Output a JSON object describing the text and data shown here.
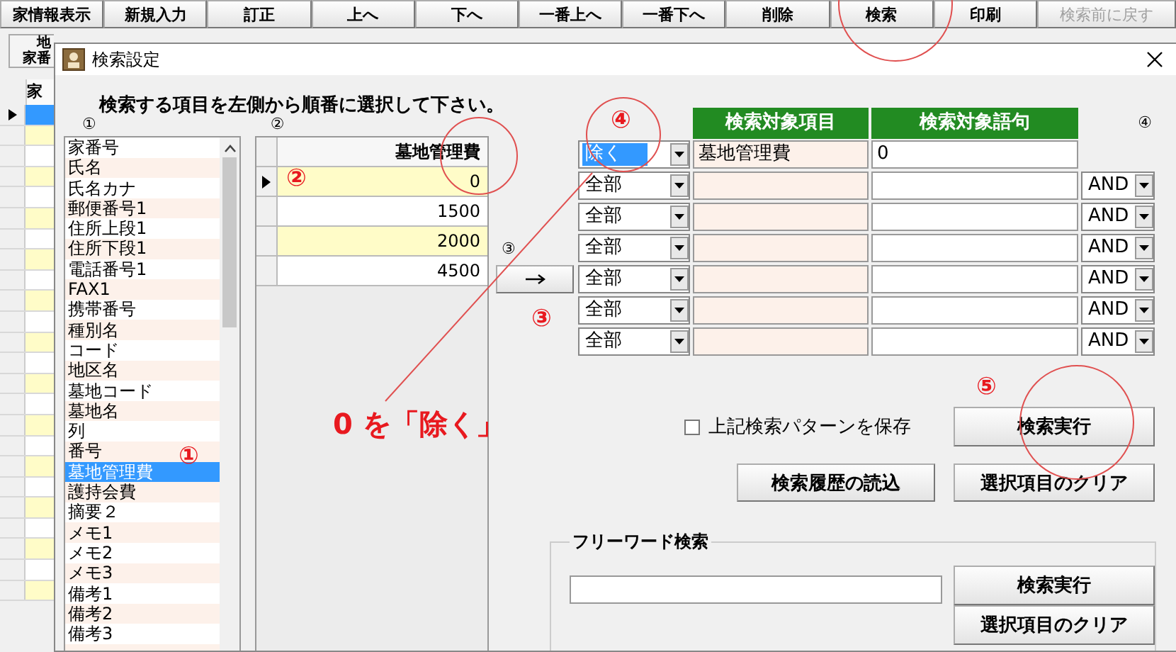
{
  "toolbar": [
    {
      "label": "家情報表示",
      "disabled": false
    },
    {
      "label": "新規入力",
      "disabled": false
    },
    {
      "label": "訂正",
      "disabled": false
    },
    {
      "label": "上へ",
      "disabled": false
    },
    {
      "label": "下へ",
      "disabled": false
    },
    {
      "label": "一番上へ",
      "disabled": false
    },
    {
      "label": "一番下へ",
      "disabled": false
    },
    {
      "label": "削除",
      "disabled": false
    },
    {
      "label": "検索",
      "disabled": false
    },
    {
      "label": "印刷",
      "disabled": false
    },
    {
      "label": "検索前に戻す",
      "disabled": true
    }
  ],
  "background_window": {
    "header_lines": [
      "地",
      "家番"
    ],
    "column_header": "家",
    "rows": [
      {
        "selected": true
      },
      {
        "selected": false
      },
      {
        "selected": false
      },
      {
        "selected": false
      },
      {
        "selected": false
      },
      {
        "selected": false
      },
      {
        "selected": false
      },
      {
        "selected": false
      },
      {
        "selected": false
      },
      {
        "selected": false
      },
      {
        "selected": false
      },
      {
        "selected": false
      },
      {
        "selected": false
      },
      {
        "selected": false
      },
      {
        "selected": false
      },
      {
        "selected": false
      },
      {
        "selected": false
      },
      {
        "selected": false
      },
      {
        "selected": false
      },
      {
        "selected": false
      },
      {
        "selected": false
      },
      {
        "selected": false
      },
      {
        "selected": false
      },
      {
        "selected": false
      }
    ]
  },
  "dialog": {
    "title": "検索設定",
    "instruction": "検索する項目を左側から順番に選択して下さい。",
    "field_list": {
      "label": "①",
      "items": [
        {
          "text": "家番号",
          "selected": false
        },
        {
          "text": "氏名",
          "selected": false
        },
        {
          "text": "氏名カナ",
          "selected": false
        },
        {
          "text": "郵便番号1",
          "selected": false
        },
        {
          "text": "住所上段1",
          "selected": false
        },
        {
          "text": "住所下段1",
          "selected": false
        },
        {
          "text": "電話番号1",
          "selected": false
        },
        {
          "text": "FAX1",
          "selected": false
        },
        {
          "text": "携帯番号",
          "selected": false
        },
        {
          "text": "種別名",
          "selected": false
        },
        {
          "text": "コード",
          "selected": false
        },
        {
          "text": "地区名",
          "selected": false
        },
        {
          "text": "墓地コード",
          "selected": false
        },
        {
          "text": "墓地名",
          "selected": false
        },
        {
          "text": "列",
          "selected": false
        },
        {
          "text": "番号",
          "selected": false
        },
        {
          "text": "墓地管理費",
          "selected": true
        },
        {
          "text": "護持会費",
          "selected": false
        },
        {
          "text": "摘要２",
          "selected": false
        },
        {
          "text": "メモ1",
          "selected": false
        },
        {
          "text": "メモ2",
          "selected": false
        },
        {
          "text": "メモ3",
          "selected": false
        },
        {
          "text": "備考1",
          "selected": false
        },
        {
          "text": "備考2",
          "selected": false
        },
        {
          "text": "備考3",
          "selected": false
        }
      ]
    },
    "value_grid": {
      "label": "②",
      "column": "墓地管理費",
      "rows": [
        {
          "value": "0",
          "current": true,
          "highlighted": true
        },
        {
          "value": "1500",
          "current": false,
          "highlighted": false
        },
        {
          "value": "2000",
          "current": false,
          "highlighted": true
        },
        {
          "value": "4500",
          "current": false,
          "highlighted": false
        }
      ]
    },
    "transfer": {
      "label": "③"
    },
    "conditions": {
      "label": "④",
      "columns": [
        "検索対象項目",
        "検索対象語句"
      ],
      "rows": [
        {
          "mode": "除く",
          "focused": true,
          "item": "墓地管理費",
          "term": "0"
        },
        {
          "mode": "全部",
          "focused": false,
          "operator": "AND"
        },
        {
          "mode": "全部",
          "focused": false,
          "operator": "AND"
        },
        {
          "mode": "全部",
          "focused": false,
          "operator": "AND"
        },
        {
          "mode": "全部",
          "focused": false,
          "operator": "AND"
        },
        {
          "mode": "全部",
          "focused": false,
          "operator": "AND"
        },
        {
          "mode": "全部",
          "focused": false,
          "operator": "AND"
        }
      ]
    },
    "save_pattern": {
      "label": "上記検索パターンを保存",
      "checked": false
    },
    "buttons": [
      "検索実行",
      "検索履歴の読込",
      "選択項目のクリア"
    ],
    "free_word": {
      "title": "フリーワード検索",
      "buttons": [
        "検索実行",
        "選択項目のクリア"
      ]
    }
  },
  "annotations": [
    {
      "text": "④"
    },
    {
      "text": "②"
    },
    {
      "text": "③"
    },
    {
      "text": "⑤"
    },
    {
      "text": "0 を「除く」"
    },
    {
      "text": "①"
    }
  ]
}
